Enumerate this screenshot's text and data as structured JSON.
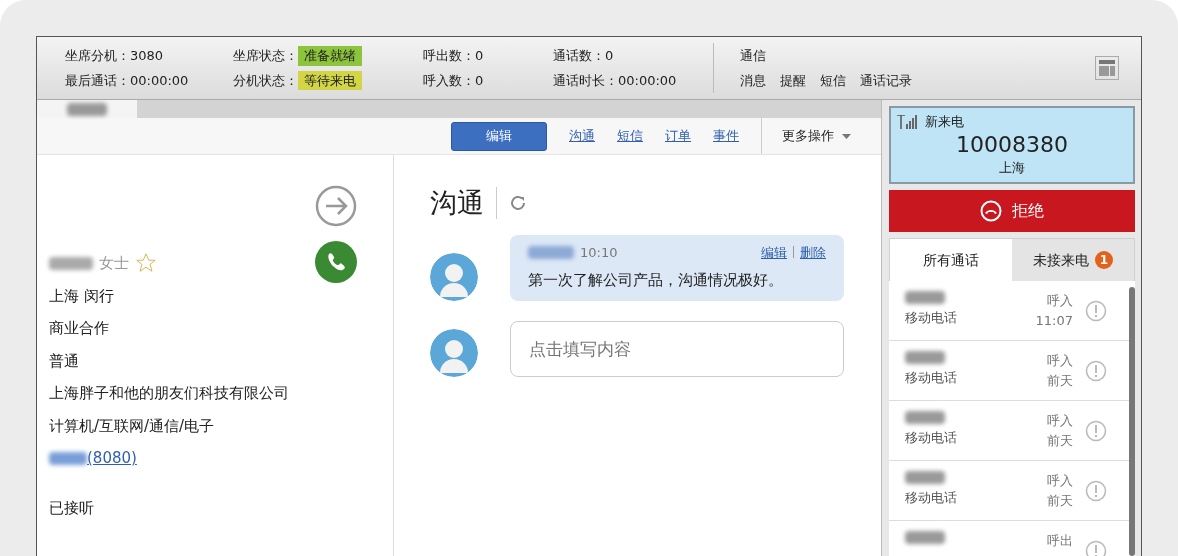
{
  "top_bar": {
    "stats": [
      {
        "label": "坐席分机：",
        "value": "3080"
      },
      {
        "label": "最后通话：",
        "value": "00:00:00"
      }
    ],
    "statuses": [
      {
        "label": "坐席状态：",
        "value": "准备就绪",
        "color": "#8cc43c"
      },
      {
        "label": "分机状态：",
        "value": "等待来电",
        "color": "#d2d646"
      }
    ],
    "counts": [
      {
        "label": "呼出数：",
        "value": "0"
      },
      {
        "label": "呼入数：",
        "value": "0"
      }
    ],
    "calls": [
      {
        "label": "通话数：",
        "value": "0"
      },
      {
        "label": "通话时长：",
        "value": "00:00:00"
      }
    ],
    "comm": {
      "title": "通信",
      "links": [
        "消息",
        "提醒",
        "短信",
        "通话记录"
      ]
    }
  },
  "toolbar": {
    "primary": "编辑",
    "links": [
      "沟通",
      "短信",
      "订单",
      "事件"
    ],
    "more": "更多操作"
  },
  "customer": {
    "title": "女士",
    "starred": false,
    "fields": [
      "上海 闵行",
      "商业合作",
      "普通",
      "上海胖子和他的朋友们科技有限公司",
      "计算机/互联网/通信/电子"
    ],
    "owner_ext": "(8080)",
    "call_status": "已接听"
  },
  "communication": {
    "title": "沟通",
    "notes": [
      {
        "time": "10:10",
        "actions": [
          "编辑",
          "删除"
        ],
        "text": "第一次了解公司产品，沟通情况极好。"
      }
    ],
    "input": {
      "placeholder": "点击填写内容"
    }
  },
  "incoming": {
    "label": "新来电",
    "number": "10008380",
    "location": "上海",
    "reject": "拒绝"
  },
  "call_tabs": [
    {
      "label": "所有通话",
      "selected": true
    },
    {
      "label": "未接来电",
      "selected": false,
      "badge": "1"
    }
  ],
  "call_log": [
    {
      "type": "移动电话",
      "direction": "呼入",
      "time": "11:07"
    },
    {
      "type": "移动电话",
      "direction": "呼入",
      "time": "前天"
    },
    {
      "type": "移动电话",
      "direction": "呼入",
      "time": "前天"
    },
    {
      "type": "移动电话",
      "direction": "呼入",
      "time": "前天"
    },
    {
      "direction": "呼出"
    }
  ]
}
